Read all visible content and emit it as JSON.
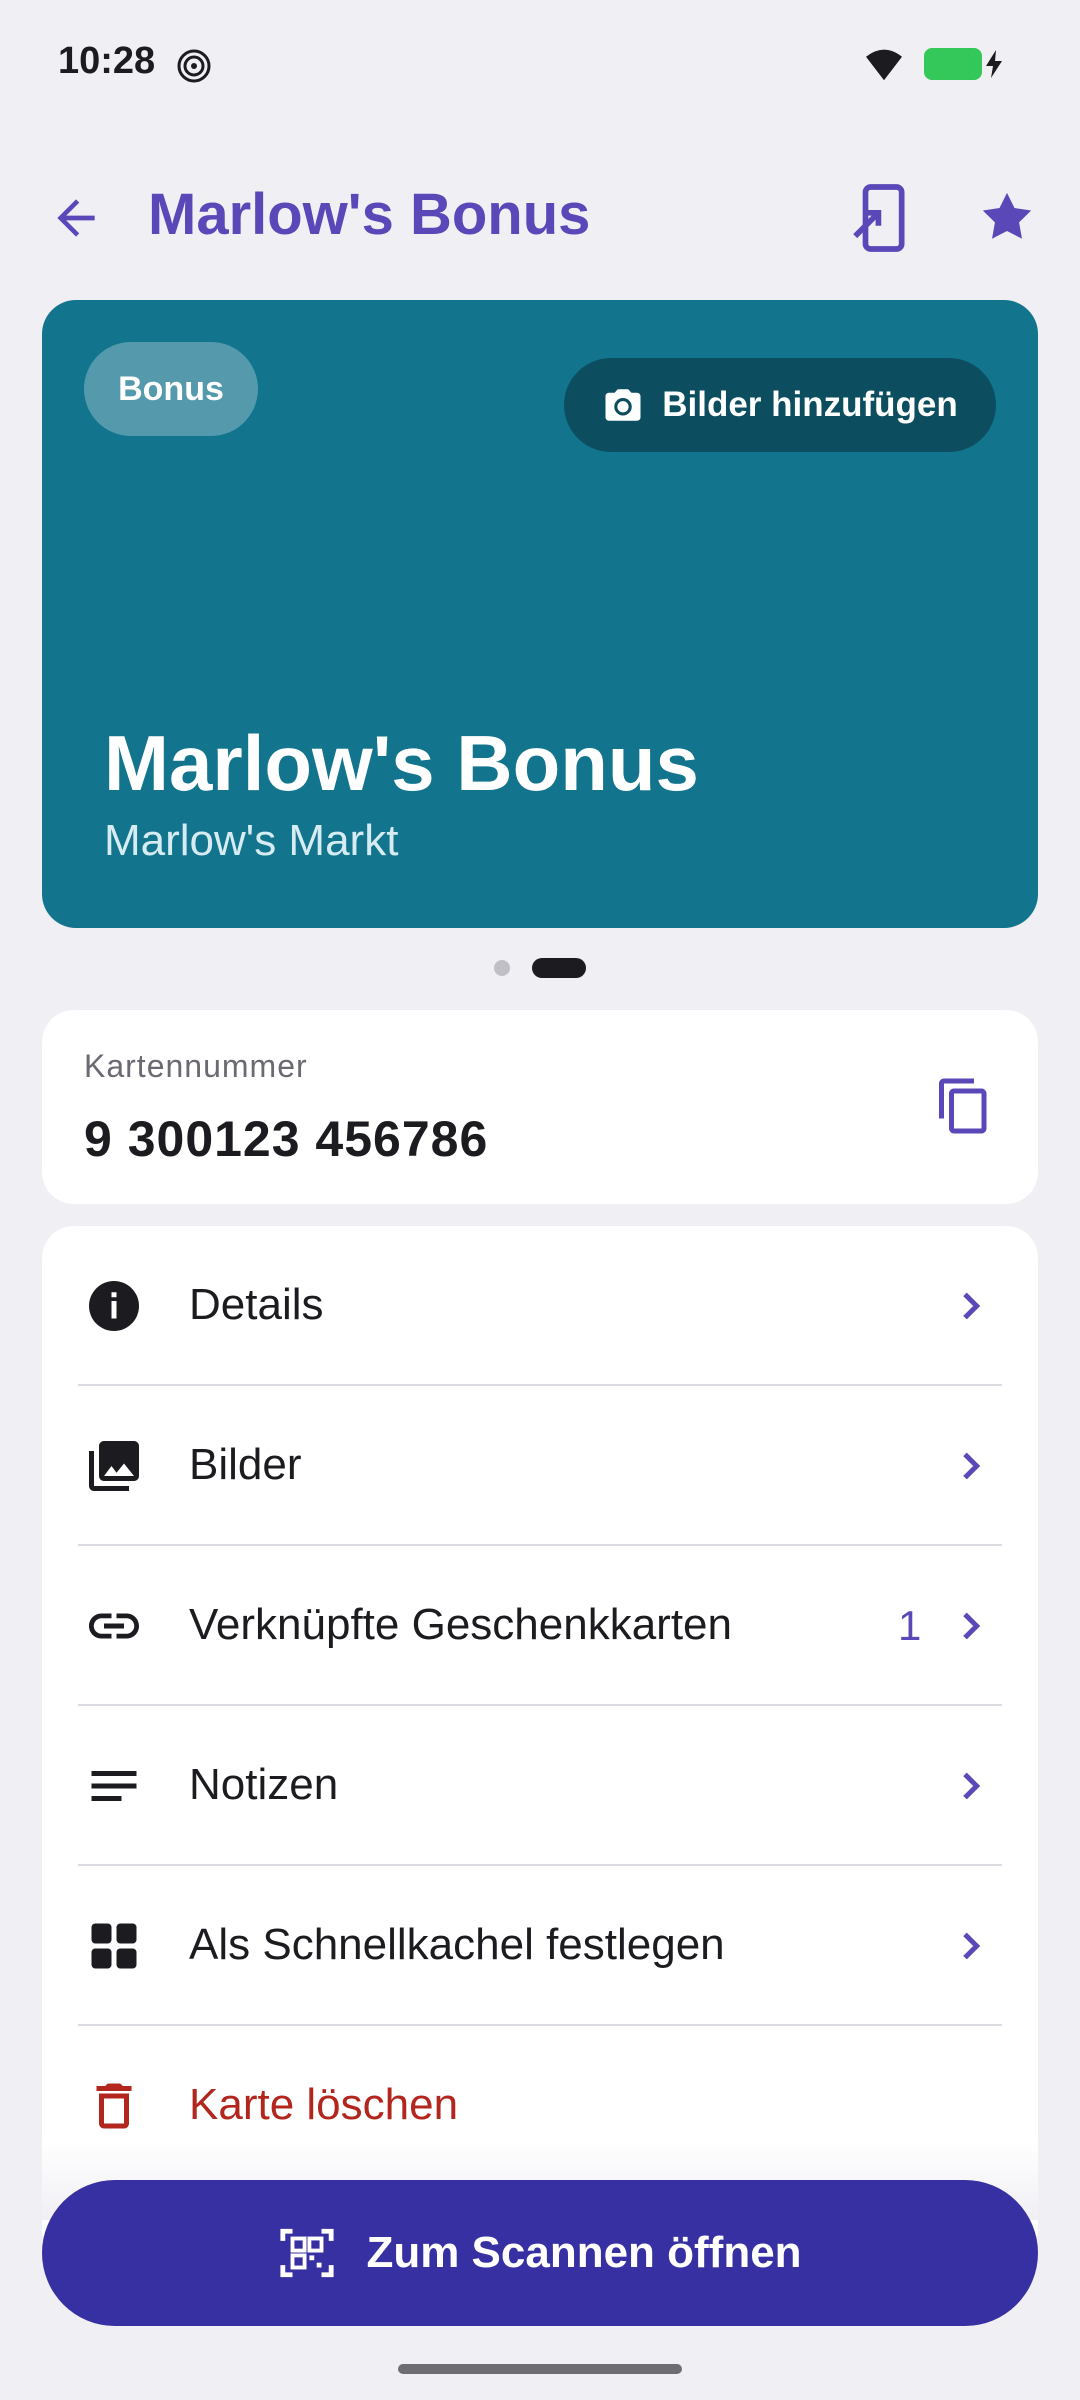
{
  "status_bar": {
    "time": "10:28"
  },
  "app_bar": {
    "title": "Marlow's Bonus"
  },
  "hero": {
    "chip": "Bonus",
    "add_images_label": "Bilder hinzufügen",
    "card_title": "Marlow's Bonus",
    "card_subtitle": "Marlow's Markt",
    "color": "#12748d"
  },
  "pager": {
    "pages": 2,
    "active": 2
  },
  "card_number": {
    "label": "Kartennummer",
    "value": "9 300123 456786"
  },
  "menu": {
    "items": [
      {
        "label": "Details",
        "icon": "info-icon"
      },
      {
        "label": "Bilder",
        "icon": "photo-library-icon"
      },
      {
        "label": "Verknüpfte Geschenkkarten",
        "icon": "link-icon",
        "count": "1"
      },
      {
        "label": "Notizen",
        "icon": "notes-icon"
      },
      {
        "label": "Als Schnellkachel festlegen",
        "icon": "grid-icon"
      },
      {
        "label": "Karte löschen",
        "icon": "trash-icon"
      }
    ]
  },
  "fab": {
    "label": "Zum Scannen öffnen"
  },
  "colors": {
    "accent": "#5a48b9",
    "fab": "#3730a3",
    "danger": "#b3261e",
    "background": "#f0eff4"
  }
}
